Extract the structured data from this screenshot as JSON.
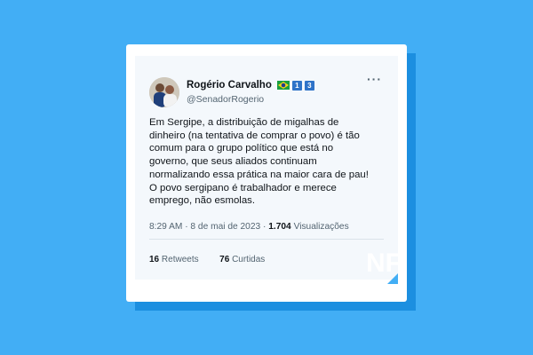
{
  "tweet": {
    "author": {
      "name": "Rogério Carvalho",
      "handle": "@SenadorRogerio",
      "flag_icon": "brazil-flag-icon",
      "badge_1": "1",
      "badge_2": "3"
    },
    "more_label": "···",
    "text_lines": [
      "Em Sergipe, a distribuição de migalhas de",
      "dinheiro (na tentativa de comprar o povo) é tão",
      "comum para o grupo político que está no",
      "governo, que seus aliados continuam",
      "normalizando essa prática na maior cara de pau!",
      "O povo sergipano é trabalhador e merece",
      "emprego, não esmolas."
    ],
    "timestamp": "8:29 AM · 8 de mai de 2023 ·",
    "views_count": "1.704",
    "views_label": "Visualizações",
    "retweets_count": "16",
    "retweets_label": "Retweets",
    "likes_count": "76",
    "likes_label": "Curtidas"
  },
  "logo": {
    "text": "NF"
  },
  "colors": {
    "background": "#42aef5",
    "card_shadow": "#1c8fe0",
    "tweet_background": "#f4f8fc",
    "badge": "#2f73c8"
  }
}
